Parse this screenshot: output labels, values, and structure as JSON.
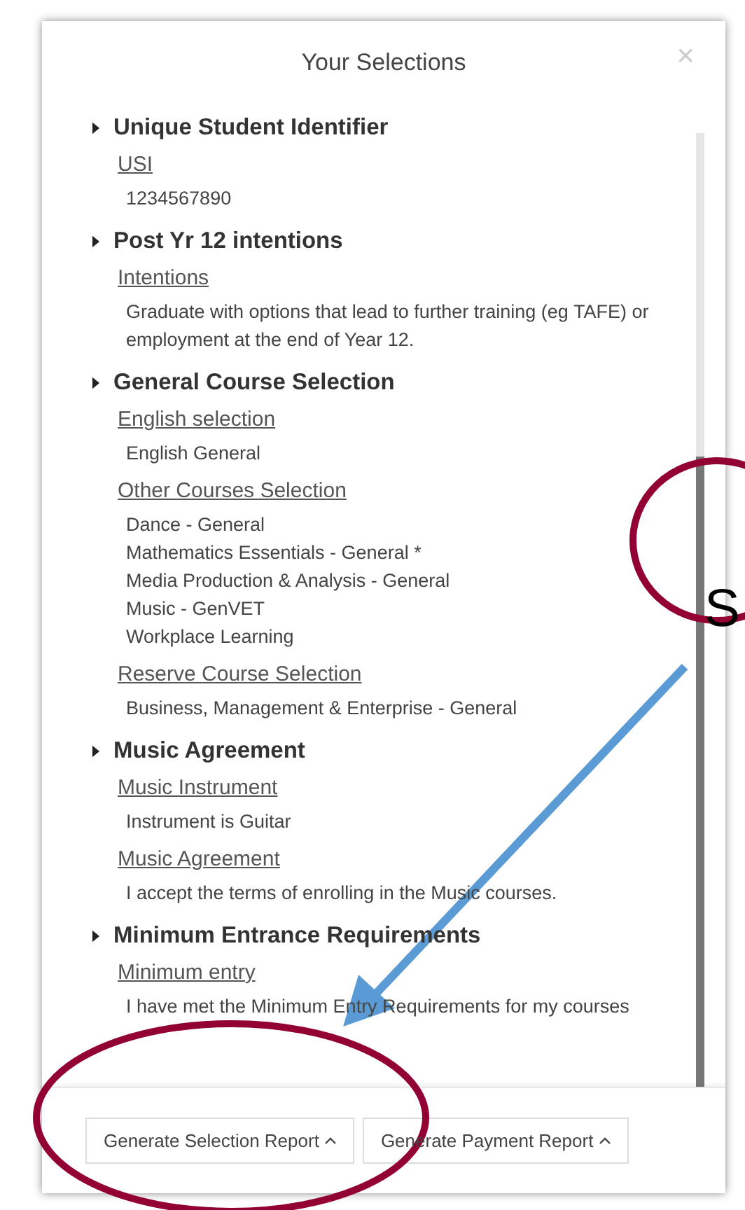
{
  "dialog": {
    "title": "Your Selections",
    "close": "×"
  },
  "sections": [
    {
      "title": "Unique Student Identifier",
      "fields": [
        {
          "label": "USI",
          "values": [
            "1234567890"
          ]
        }
      ]
    },
    {
      "title": "Post Yr 12 intentions",
      "fields": [
        {
          "label": "Intentions",
          "values": [
            "Graduate with options that lead to further training (eg TAFE) or employment at the end of Year 12."
          ]
        }
      ]
    },
    {
      "title": "General Course Selection",
      "fields": [
        {
          "label": "English selection",
          "values": [
            "English General"
          ]
        },
        {
          "label": "Other Courses Selection",
          "values": [
            "Dance - General",
            "Mathematics Essentials - General *",
            "Media Production & Analysis - General",
            "Music - GenVET",
            "Workplace Learning"
          ]
        },
        {
          "label": "Reserve Course Selection",
          "values": [
            "Business, Management & Enterprise - General"
          ]
        }
      ]
    },
    {
      "title": "Music Agreement",
      "fields": [
        {
          "label": "Music Instrument",
          "values": [
            "Instrument is Guitar"
          ]
        },
        {
          "label": "Music Agreement",
          "values": [
            "I accept the terms of enrolling in the Music courses."
          ]
        }
      ]
    },
    {
      "title": "Minimum Entrance Requirements",
      "fields": [
        {
          "label": "Minimum entry",
          "values": [
            "I have met the Minimum Entry Requirements for my courses"
          ]
        }
      ]
    }
  ],
  "buttons": [
    "Generate Selection Report",
    "Generate Payment Report"
  ],
  "annotation": {
    "text": "S"
  }
}
